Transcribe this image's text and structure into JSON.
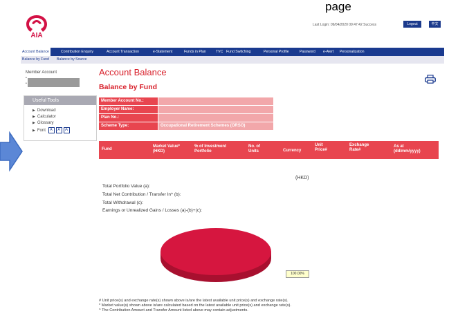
{
  "header": {
    "top_text": "page",
    "login_info": "Last Login: 09/04/2020 09:47:42  Success",
    "logout_label": "Logout",
    "lang_label": "中文"
  },
  "nav": {
    "items": [
      "Account Balance",
      "Contribution Enquiry",
      "Account Transaction",
      "e-Statement",
      "Funds in Plan",
      "TVC",
      "Fund Switching",
      "Personal Profile",
      "Password",
      "e-Alert",
      "Personalization"
    ],
    "subitems": [
      "Balance by Fund",
      "Balance by Source"
    ]
  },
  "sidebar": {
    "member_account_label": "Member Account",
    "useful_tools_title": "Useful Tools",
    "tools": [
      "Download",
      "Calculator",
      "Glossary",
      "Font"
    ],
    "font_sizes": [
      "A",
      "A",
      "A"
    ]
  },
  "main": {
    "page_title": "Account Balance",
    "section_title": "Balance by Fund",
    "info_rows": [
      {
        "label": "Member Account No.:",
        "value": ""
      },
      {
        "label": "Employer Name:",
        "value": ""
      },
      {
        "label": "Plan No.:",
        "value": ""
      },
      {
        "label": "Scheme Type:",
        "value": "Occupational Retirement Schemes (ORSO)"
      }
    ],
    "fund_table_headers": [
      {
        "line1": "Fund",
        "line2": ""
      },
      {
        "line1": "Market Value*",
        "line2": "(HKD)"
      },
      {
        "line1": "% of Investment",
        "line2": "Portfolio"
      },
      {
        "line1": "No. of",
        "line2": "Units"
      },
      {
        "line1": "Currency",
        "line2": ""
      },
      {
        "line1": "Unit",
        "line2": "Price#"
      },
      {
        "line1": "Exchange",
        "line2": "Rate#"
      },
      {
        "line1": "As at",
        "line2": "(dd/mm/yyyy)"
      }
    ],
    "currency_label": "(HKD)",
    "summary": [
      "Total Portfolio Value (a):",
      "Total Net Contribution / Transfer In^ (b):",
      "Total Withdrawal (c):",
      "Earnings or Unrealized Gains / Losses (a)-(b)+(c):"
    ],
    "pie": {
      "slices": [
        {
          "value": 100,
          "color": "#d6163f"
        }
      ],
      "label": "100.00%"
    },
    "footnotes": [
      "# Unit price(s) and exchange rate(s) shown above is/are the latest available unit price(s) and exchange rate(s).",
      "* Market value(s) shown above is/are calculated based on the latest available unit price(s) and exchange rate(s).",
      "^ The Contribution Amount and Transfer Amount listed above may contain adjustments."
    ]
  }
}
